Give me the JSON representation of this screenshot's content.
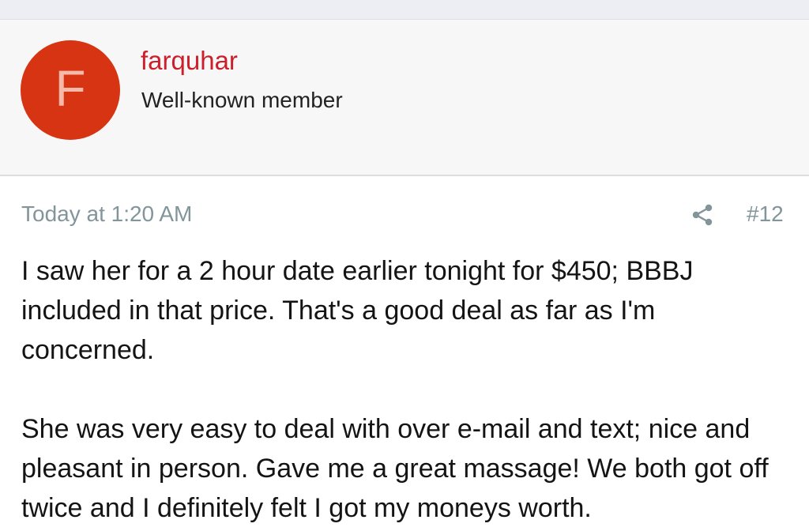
{
  "author": {
    "avatar_letter": "F",
    "avatar_color": "#d63413",
    "username": "farquhar",
    "username_color": "#cc1f2a",
    "title": "Well-known member"
  },
  "post": {
    "timestamp": "Today at 1:20 AM",
    "share_icon": "share-icon",
    "number": "#12",
    "paragraphs": [
      "I saw her for a 2 hour date earlier tonight for $450; BBBJ included in that price. That's a good deal as far as I'm concerned.",
      "She was very easy to deal with over e-mail and text; nice and pleasant in person. Gave me a great massage! We both got off twice and I definitely felt I got my moneys worth."
    ]
  }
}
